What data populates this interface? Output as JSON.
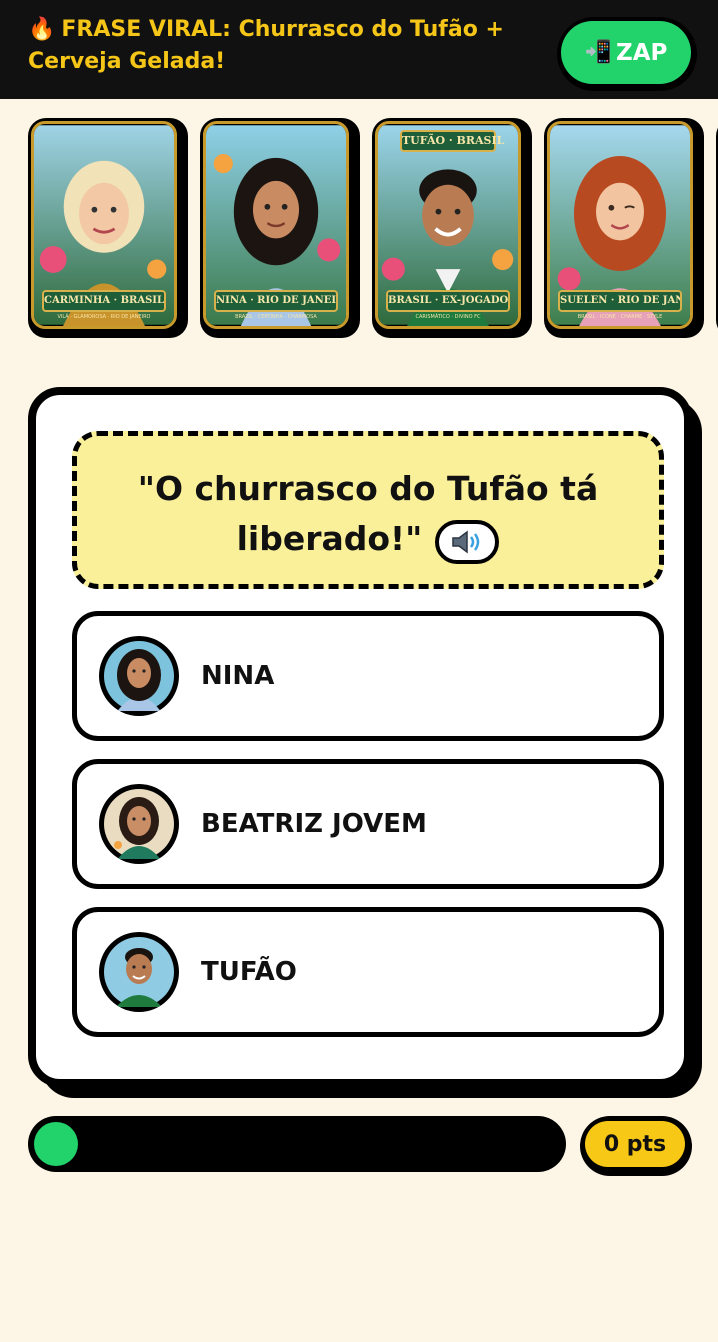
{
  "header": {
    "title_icon": "fire-icon",
    "title": "FRASE VIRAL: Churrasco do Tufão + Cerveja Gelada!",
    "share_button": {
      "icon": "phone-arrow-icon",
      "label": "ZAP"
    }
  },
  "cards": [
    {
      "name": "CARMINHA · BRASIL",
      "subtitle": "VILÃ · GLAMOROSA · RIO DE JANEIRO",
      "top": ""
    },
    {
      "name": "NINA · RIO DE JANEIRO",
      "subtitle": "BRAZIL · CERTINHA · CHARMOSA",
      "top": ""
    },
    {
      "name": "BRASIL · EX-JOGADOR",
      "subtitle": "CARISMÁTICO · DIVINO FC",
      "top": "TUFÃO · BRASIL"
    },
    {
      "name": "SUELEN · RIO DE JANEIRO",
      "subtitle": "BRASIL · ICONE · CHARME · STYLE",
      "top": ""
    }
  ],
  "quiz": {
    "phrase_line1": "\"O churrasco do Tufão tá",
    "phrase_line2": "liberado!\"",
    "audio_icon": "speaker-icon",
    "options": [
      {
        "label": "NINA"
      },
      {
        "label": "BEATRIZ JOVEM"
      },
      {
        "label": "TUFÃO"
      }
    ]
  },
  "progress": {
    "value": 0.0
  },
  "score": {
    "label": "0 pts"
  },
  "colors": {
    "header_bg": "#111111",
    "header_text": "#f5c518",
    "zap_green": "#22d36b",
    "phrase_bg": "#fbf09a",
    "score_yellow": "#f7c815",
    "page_bg": "#fdf6e6"
  }
}
